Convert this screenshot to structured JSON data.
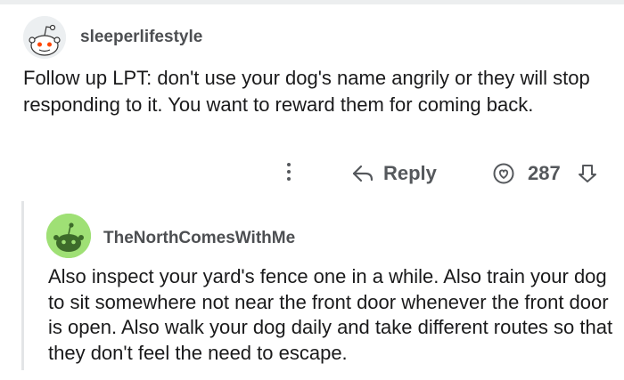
{
  "comment": {
    "username": "sleeperlifestyle",
    "body": "Follow up LPT: don't use your dog's name angrily or they will stop responding to it.  You want to reward them for coming back.",
    "actions": {
      "reply_label": "Reply",
      "score": "287"
    }
  },
  "reply": {
    "username": "TheNorthComesWithMe",
    "body": "Also inspect your yard's fence one in a while. Also train your dog to sit somewhere not near the front door whenever the front door is open. Also walk your dog daily and take different routes so that they don't feel the need to escape."
  },
  "colors": {
    "accent_green": "#9fe075",
    "text_gray": "#55585c",
    "thread_line": "#e3e5e7"
  },
  "icons": {
    "avatar1": "snoo-avatar-icon",
    "avatar2": "snoo-avatar-icon",
    "more": "more-options-icon",
    "reply": "reply-arrow-icon",
    "upvote": "upvote-icon",
    "downvote": "downvote-icon"
  }
}
